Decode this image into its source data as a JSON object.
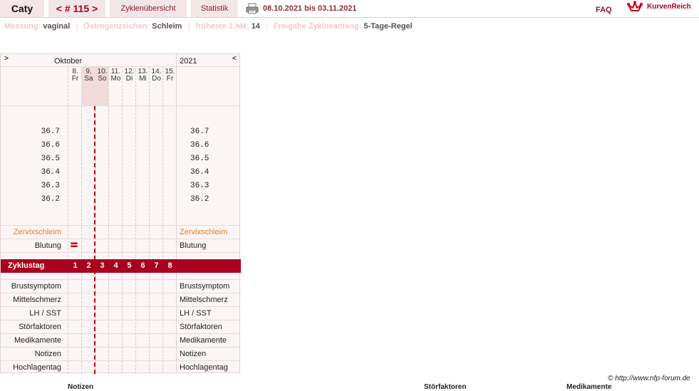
{
  "topbar": {
    "user": "Caty",
    "cycle": "< # 115 >",
    "overview": "Zyklenübersicht",
    "stats": "Statistik",
    "daterange": "08.10.2021 bis 03.11.2021",
    "faq": "FAQ",
    "logo": "KurvenReich"
  },
  "settings": {
    "messung_label": "Messung:",
    "messung_value": "vaginal",
    "oestrogen_label": "Östrogenzeichen:",
    "oestrogen_value": "Schleim",
    "hm_label": "früheste 1.hM:",
    "hm_value": "14",
    "freigabe_label": "Freigabe Zyklusanfang:",
    "freigabe_value": "5-Tage-Regel"
  },
  "chart": {
    "nav_prev": ">",
    "nav_next": "<",
    "month": "Oktober",
    "year": "2021",
    "days": [
      {
        "date": "8.",
        "weekday": "Fr"
      },
      {
        "date": "9.",
        "weekday": "Sa"
      },
      {
        "date": "10.",
        "weekday": "So"
      },
      {
        "date": "11.",
        "weekday": "Mo"
      },
      {
        "date": "12.",
        "weekday": "Di"
      },
      {
        "date": "13.",
        "weekday": "Mi"
      },
      {
        "date": "14.",
        "weekday": "Do"
      },
      {
        "date": "15.",
        "weekday": "Fr"
      }
    ],
    "temps": [
      "36.7",
      "36.6",
      "36.5",
      "36.4",
      "36.3",
      "36.2"
    ],
    "zervix_label": "Zervixschleim",
    "blutung_label": "Blutung",
    "zyklustag_label": "Zyklustag",
    "zyklustage": [
      "1",
      "2",
      "3",
      "4",
      "5",
      "6",
      "7",
      "8"
    ],
    "bleeding_day_index": 0,
    "coverline_after_day": 2,
    "symptoms": [
      "Brustsymptom",
      "Mittelschmerz",
      "LH / SST",
      "Störfaktoren",
      "Medikamente",
      "Notizen",
      "Hochlagentag"
    ]
  },
  "footer": {
    "copyright": "© http://www.nfp-forum.de",
    "notizen": "Notizen",
    "stoerfaktoren": "Störfaktoren",
    "medikamente": "Medikamente"
  },
  "colors": {
    "accent": "#a8001f",
    "tab_bg": "#f3e6e6",
    "orange": "#ee7a1c"
  }
}
